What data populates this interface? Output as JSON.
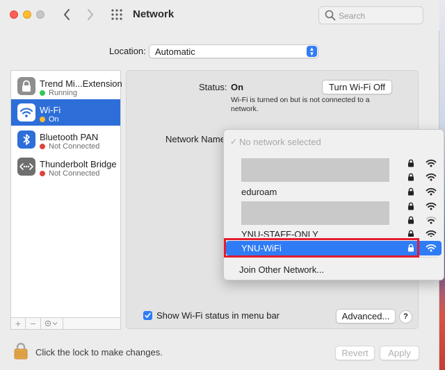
{
  "window": {
    "title": "Network",
    "search_placeholder": "Search"
  },
  "location": {
    "label": "Location:",
    "value": "Automatic"
  },
  "sidebar": {
    "items": [
      {
        "name": "Trend Mi...Extension",
        "status": "Running",
        "status_color": "#34c759",
        "icon": "lock-icon"
      },
      {
        "name": "Wi-Fi",
        "status": "On",
        "status_color": "#febc2e",
        "icon": "wifi-icon"
      },
      {
        "name": "Bluetooth PAN",
        "status": "Not Connected",
        "status_color": "#e0443e",
        "icon": "bluetooth-icon"
      },
      {
        "name": "Thunderbolt Bridge",
        "status": "Not Connected",
        "status_color": "#e0443e",
        "icon": "thunderbolt-bridge-icon"
      }
    ]
  },
  "detail": {
    "status_label": "Status:",
    "status_value": "On",
    "turn_off_label": "Turn Wi-Fi Off",
    "status_description": "Wi-Fi is turned on but is not connected to a network.",
    "network_name_label": "Network Name",
    "show_wifi_label": "Show Wi-Fi status in menu bar",
    "show_wifi_checked": true,
    "advanced_label": "Advanced...",
    "help_label": "?"
  },
  "network_menu": {
    "header": "No network selected",
    "networks": [
      {
        "name": "",
        "redacted": true
      },
      {
        "name": "eduroam",
        "redacted": false
      },
      {
        "name": "",
        "redacted": true
      },
      {
        "name": "YNU-STAFF-ONLY",
        "redacted": false
      },
      {
        "name": "YNU-WiFi",
        "redacted": false,
        "selected": true
      }
    ],
    "join_other_label": "Join Other Network..."
  },
  "footer": {
    "lock_label": "Click the lock to make changes.",
    "revert_label": "Revert",
    "apply_label": "Apply"
  },
  "colors": {
    "accent": "#2f7cf6",
    "sidebar_selected": "#2d6ed9",
    "highlight_outline": "#e31c2f"
  }
}
